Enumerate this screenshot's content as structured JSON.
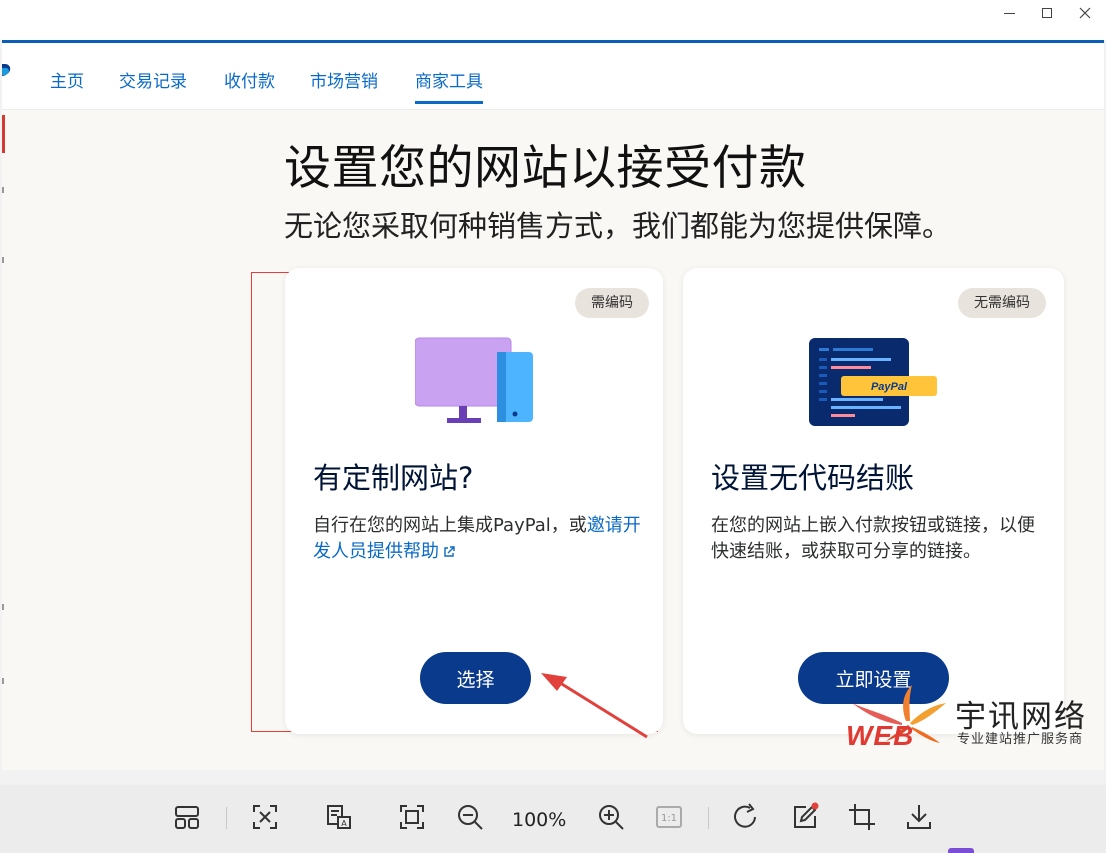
{
  "nav": {
    "items": [
      "主页",
      "交易记录",
      "收付款",
      "市场营销",
      "商家工具"
    ],
    "active": "商家工具"
  },
  "hero": {
    "title": "设置您的网站以接受付款",
    "subtitle": "无论您采取何种销售方式，我们都能为您提供保障。"
  },
  "cards": [
    {
      "badge": "需编码",
      "title": "有定制网站?",
      "desc_prefix": "自行在您的网站上集成PayPal，或",
      "desc_link": "邀请开发人员提供帮助",
      "button": "选择"
    },
    {
      "badge": "无需编码",
      "title": "设置无代码结账",
      "desc": "在您的网站上嵌入付款按钮或链接，以便快速结账，或获取可分享的链接。",
      "button": "立即设置",
      "illustration_label": "PayPal"
    }
  ],
  "watermark": {
    "name": "宇讯网络",
    "tagline": "专业建站推广服务商",
    "brand": "WEB"
  },
  "toolbar": {
    "zoom": "100%",
    "icons": [
      "layout-icon",
      "fit-icon",
      "ocr-icon",
      "fullscreen-icon",
      "zoom-out-icon",
      "zoom-in-icon",
      "actual-size-icon",
      "rotate-icon",
      "edit-icon",
      "crop-icon",
      "download-icon"
    ],
    "actual_size_label": "1:1"
  },
  "colors": {
    "primary": "#0a3a8c",
    "link": "#0a6ac8",
    "highlight": "#e2403a"
  }
}
